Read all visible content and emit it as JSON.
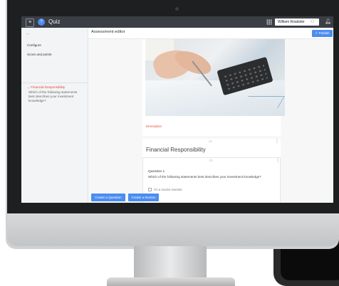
{
  "app": {
    "title": "Quiz",
    "user_name": "William Roadster"
  },
  "header": {
    "page_title": "Assessment editor",
    "publish_label": "Publish"
  },
  "sidebar": {
    "items": [
      {
        "label": "Configure"
      },
      {
        "label": "Score and points"
      }
    ],
    "section": {
      "title": "Financial Responsibility",
      "description": "Which of the following statements best describes your investment knowledge?"
    }
  },
  "content": {
    "image_description_label": "Description",
    "section_title": "Financial Responsibility",
    "question": {
      "title": "Question 1",
      "text": "Which of the following statements best describes your investment knowledge?",
      "first_option": "I'm a novice investor"
    }
  },
  "actions": {
    "create_question": "Create a Question",
    "create_section": "Create a Section"
  },
  "colors": {
    "accent": "#4b8df1",
    "appbar": "#3b3e44",
    "active_section": "#e04a3a"
  }
}
